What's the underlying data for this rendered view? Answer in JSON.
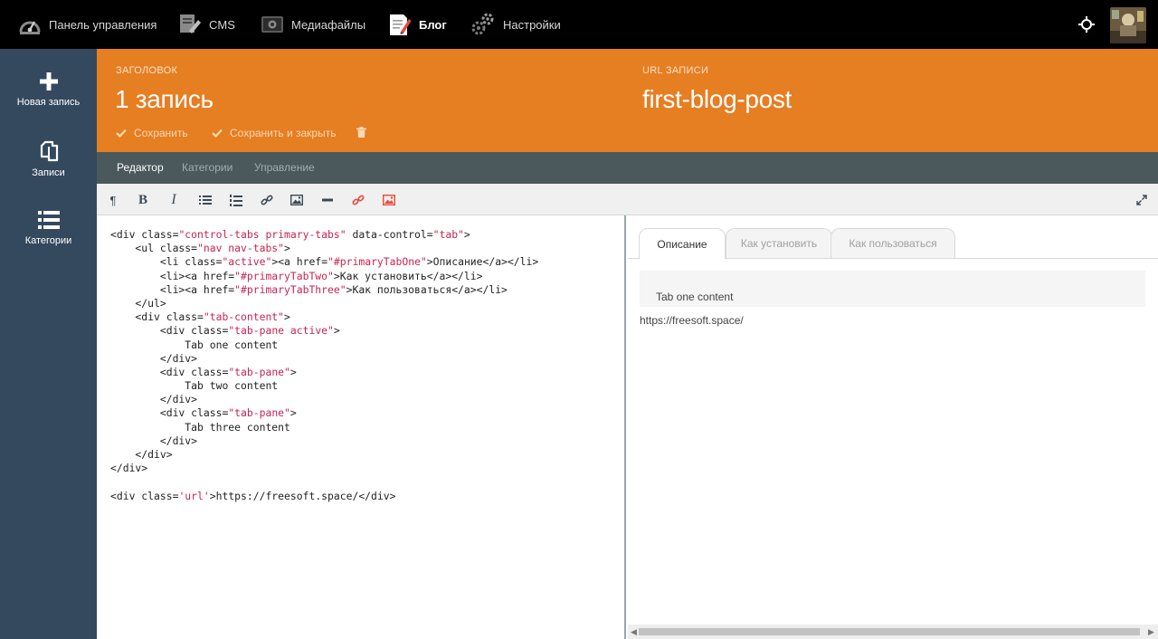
{
  "topnav": {
    "items": [
      {
        "label": "Панель управления",
        "icon": "dashboard-icon"
      },
      {
        "label": "CMS",
        "icon": "cms-icon"
      },
      {
        "label": "Медиафайлы",
        "icon": "media-icon"
      },
      {
        "label": "Блог",
        "icon": "blog-icon",
        "active": true
      },
      {
        "label": "Настройки",
        "icon": "settings-icon"
      }
    ],
    "right_icon": "crosshair-icon"
  },
  "sidebar": {
    "items": [
      {
        "label": "Новая запись",
        "icon": "plus-icon"
      },
      {
        "label": "Записи",
        "icon": "copy-icon"
      },
      {
        "label": "Категории",
        "icon": "list-icon"
      }
    ]
  },
  "header": {
    "title_label": "ЗАГОЛОВОК",
    "title_value": "1 запись",
    "url_label": "URL ЗАПИСИ",
    "url_value": "first-blog-post",
    "actions": {
      "save": "Сохранить",
      "save_close": "Сохранить и закрыть"
    }
  },
  "subtabs": [
    "Редактор",
    "Категории",
    "Управление"
  ],
  "code": {
    "lines": [
      [
        [
          "<div class=",
          ""
        ],
        [
          "\"control-tabs primary-tabs\"",
          "s"
        ],
        [
          " data-control=",
          ""
        ],
        [
          "\"tab\"",
          "s"
        ],
        [
          ">",
          ""
        ]
      ],
      [
        [
          "    <ul class=",
          ""
        ],
        [
          "\"nav nav-tabs\"",
          "s"
        ],
        [
          ">",
          ""
        ]
      ],
      [
        [
          "        <li class=",
          ""
        ],
        [
          "\"active\"",
          "s"
        ],
        [
          "><a href=",
          ""
        ],
        [
          "\"#primaryTabOne\"",
          "s"
        ],
        [
          ">Описание</a></li>",
          ""
        ]
      ],
      [
        [
          "        <li><a href=",
          ""
        ],
        [
          "\"#primaryTabTwo\"",
          "s"
        ],
        [
          ">Как установить</a></li>",
          ""
        ]
      ],
      [
        [
          "        <li><a href=",
          ""
        ],
        [
          "\"#primaryTabThree\"",
          "s"
        ],
        [
          ">Как пользоваться</a></li>",
          ""
        ]
      ],
      [
        [
          "    </ul>",
          ""
        ]
      ],
      [
        [
          "    <div class=",
          ""
        ],
        [
          "\"tab-content\"",
          "s"
        ],
        [
          ">",
          ""
        ]
      ],
      [
        [
          "        <div class=",
          ""
        ],
        [
          "\"tab-pane active\"",
          "s"
        ],
        [
          ">",
          ""
        ]
      ],
      [
        [
          "            Tab one content",
          ""
        ]
      ],
      [
        [
          "        </div>",
          ""
        ]
      ],
      [
        [
          "        <div class=",
          ""
        ],
        [
          "\"tab-pane\"",
          "s"
        ],
        [
          ">",
          ""
        ]
      ],
      [
        [
          "            Tab two content",
          ""
        ]
      ],
      [
        [
          "        </div>",
          ""
        ]
      ],
      [
        [
          "        <div class=",
          ""
        ],
        [
          "\"tab-pane\"",
          "s"
        ],
        [
          ">",
          ""
        ]
      ],
      [
        [
          "            Tab three content",
          ""
        ]
      ],
      [
        [
          "        </div>",
          ""
        ]
      ],
      [
        [
          "    </div>",
          ""
        ]
      ],
      [
        [
          "</div>",
          ""
        ]
      ],
      [
        [
          "",
          ""
        ]
      ],
      [
        [
          "<div class=",
          ""
        ],
        [
          "'url'",
          "s"
        ],
        [
          ">https://freesoft.space/</div>",
          ""
        ]
      ]
    ]
  },
  "preview": {
    "tabs": [
      "Описание",
      "Как установить",
      "Как пользоваться"
    ],
    "content": "Tab one content",
    "url": "https://freesoft.space/"
  },
  "colors": {
    "topnav": "#000000",
    "sidebar": "#34495e",
    "header": "#e67e22",
    "subtabs": "#4b585c",
    "code_string": "#c7254e"
  }
}
